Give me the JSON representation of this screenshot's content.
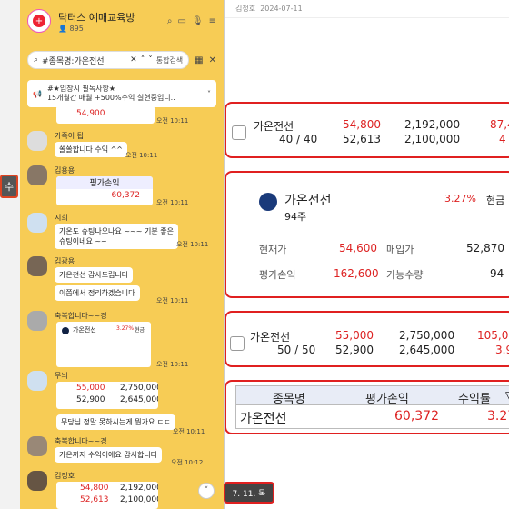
{
  "left_tag": "수",
  "chat": {
    "title": "닥터스 예매교육방",
    "subtitle": "895",
    "search_value": "#종목명:가온전선",
    "search_btn": "통합검색",
    "notice_line1": "#★입장시 필독사항★",
    "notice_line2": "15개월간 매월 +500%수익 실현중입니..",
    "messages": [
      {
        "value": "54,900",
        "time": "오전 10:11"
      },
      {
        "sender": "가족이 됩!",
        "text": "쏠쏠합니다 수익 ^^",
        "time": "오전 10:11"
      },
      {
        "sender": "김용용",
        "label": "평가손익",
        "value": "60,372",
        "time": "오전 10:11"
      },
      {
        "sender": "지희",
        "line1": "가온도 슈팅나오나요 ~~~ 기분 좋은",
        "line2": "슈팅이네요 ~~",
        "time": "오전 10:11"
      },
      {
        "sender": "김광용",
        "line1": "가온전선 감사드립니다",
        "line2": "이쯤에서 정리하겠습니다",
        "time": "오전 10:11"
      },
      {
        "sender": "축복합니다~~경",
        "card_name": "가온전선",
        "card_pct": "3.27%",
        "card_extra": "현금",
        "time": "오전 10:11"
      },
      {
        "sender": "무늬",
        "r1c1": "55,000",
        "r1c2": "2,750,000",
        "r2c1": "52,900",
        "r2c2": "2,645,000",
        "text": "무당님 정말 못하시는게 뭔가요 ㄷㄷ",
        "time": "오전 10:11"
      },
      {
        "sender": "축복합니다~~경",
        "text": "가온까지 수익이에요 감사합니다",
        "time": "오전 10:12"
      },
      {
        "sender": "김정호",
        "r1c1": "54,800",
        "r1c2": "2,192,000",
        "r2c1": "52,613",
        "r2c2": "2,100,000"
      }
    ]
  },
  "right": {
    "header_name": "김정호",
    "header_date": "2024-07-11",
    "box1": {
      "name": "가온전선",
      "qty": "40 / 40",
      "price1": "54,800",
      "price2": "52,613",
      "amt1": "2,192,000",
      "amt2": "2,100,000",
      "pnl1": "87,4",
      "pnl2": "4"
    },
    "box2": {
      "name": "가온전선",
      "pct": "3.27%",
      "cash": "현금",
      "shares": "94주",
      "l1": "현재가",
      "v1": "54,600",
      "l2": "매입가",
      "v2": "52,870",
      "l3": "평가손익",
      "v3": "162,600",
      "l4": "가능수량",
      "v4": "94"
    },
    "box3": {
      "name": "가온전선",
      "qty": "50 / 50",
      "price1": "55,000",
      "price2": "52,900",
      "amt1": "2,750,000",
      "amt2": "2,645,000",
      "pnl1": "105,0",
      "pnl2": "3.9"
    },
    "box4": {
      "h1": "종목명",
      "h2": "평가손익",
      "h3": "수익률",
      "name": "가온전선",
      "pnl": "60,372",
      "rate": "3.27"
    }
  },
  "date_tag": "7. 11. 목"
}
